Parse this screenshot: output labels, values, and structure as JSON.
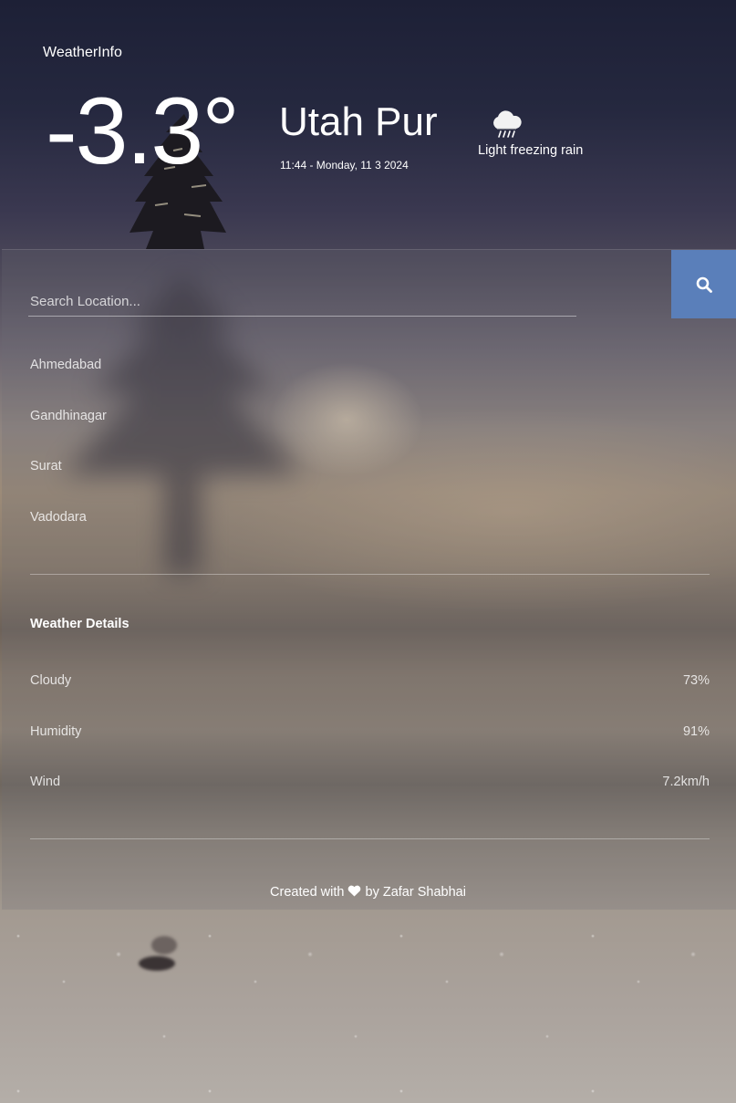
{
  "app": {
    "brand": "WeatherInfo"
  },
  "current": {
    "temperature": "-3.3°",
    "city": "Utah Pur",
    "datetime": "11:44 - Monday, 11 3 2024",
    "condition": "Light freezing rain",
    "condition_icon": "cloud-rain-icon"
  },
  "search": {
    "placeholder": "Search Location...",
    "value": "",
    "button_icon": "search-icon",
    "button_color": "#5a7fba"
  },
  "locations": [
    "Ahmedabad",
    "Gandhinagar",
    "Surat",
    "Vadodara"
  ],
  "details": {
    "title": "Weather Details",
    "rows": [
      {
        "label": "Cloudy",
        "value": "73%"
      },
      {
        "label": "Humidity",
        "value": "91%"
      },
      {
        "label": "Wind",
        "value": "7.2km/h"
      }
    ]
  },
  "footer": {
    "prefix": "Created with",
    "icon": "heart-icon",
    "suffix": "by Zafar Shabhai"
  }
}
